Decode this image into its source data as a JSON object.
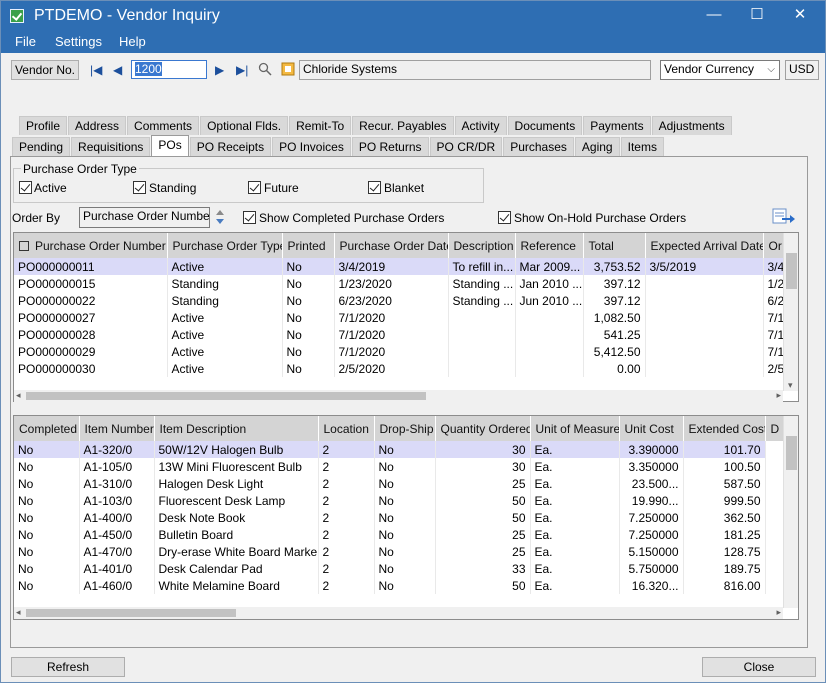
{
  "window": {
    "title": "PTDEMO - Vendor Inquiry",
    "controls": [
      "—",
      "☐",
      "✕"
    ]
  },
  "menu": [
    "File",
    "Settings",
    "Help"
  ],
  "header": {
    "vendor_button": "Vendor No.",
    "vendor_no": "1200",
    "vendor_name": "Chloride Systems",
    "currency_select": "Vendor Currency",
    "currency_code": "USD"
  },
  "tabs_row1": [
    "Profile",
    "Address",
    "Comments",
    "Optional Flds.",
    "Remit-To",
    "Recur. Payables",
    "Activity",
    "Documents",
    "Payments",
    "Adjustments"
  ],
  "tabs_row2": [
    "Pending",
    "Requisitions",
    "POs",
    "PO Receipts",
    "PO Invoices",
    "PO Returns",
    "PO CR/DR",
    "Purchases",
    "Aging",
    "Items"
  ],
  "active_tab": "POs",
  "po_type": {
    "label": "Purchase Order Type",
    "options": [
      {
        "label": "Active",
        "checked": true
      },
      {
        "label": "Standing",
        "checked": true
      },
      {
        "label": "Future",
        "checked": true
      },
      {
        "label": "Blanket",
        "checked": true
      }
    ]
  },
  "order_by": {
    "label": "Order By",
    "value": "Purchase Order Number",
    "show_completed": "Show Completed Purchase Orders",
    "show_onhold": "Show On-Hold Purchase Orders"
  },
  "po_grid": {
    "headers": [
      "Purchase Order Number",
      "Purchase Order Type",
      "Printed",
      "Purchase Order Date",
      "Description",
      "Reference",
      "Total",
      "Expected Arrival Date",
      "Or"
    ],
    "rows": [
      [
        "PO000000011",
        "Active",
        "No",
        "3/4/2019",
        "To refill in...",
        "Mar 2009...",
        "3,753.52",
        "3/5/2019",
        "3/4"
      ],
      [
        "PO000000015",
        "Standing",
        "No",
        "1/23/2020",
        "Standing ...",
        "Jan 2010 ...",
        "397.12",
        "",
        "1/2"
      ],
      [
        "PO000000022",
        "Standing",
        "No",
        "6/23/2020",
        "Standing ...",
        "Jun 2010 ...",
        "397.12",
        "",
        "6/2"
      ],
      [
        "PO000000027",
        "Active",
        "No",
        "7/1/2020",
        "",
        "",
        "1,082.50",
        "",
        "7/1"
      ],
      [
        "PO000000028",
        "Active",
        "No",
        "7/1/2020",
        "",
        "",
        "541.25",
        "",
        "7/1"
      ],
      [
        "PO000000029",
        "Active",
        "No",
        "7/1/2020",
        "",
        "",
        "5,412.50",
        "",
        "7/1"
      ],
      [
        "PO000000030",
        "Active",
        "No",
        "2/5/2020",
        "",
        "",
        "0.00",
        "",
        "2/5"
      ]
    ]
  },
  "item_grid": {
    "headers": [
      "Completed",
      "Item Number",
      "Item Description",
      "Location",
      "Drop-Ship",
      "Quantity Ordered",
      "Unit of Measure",
      "Unit Cost",
      "Extended Cost",
      "D"
    ],
    "rows": [
      [
        "No",
        "A1-320/0",
        "50W/12V Halogen Bulb",
        "2",
        "No",
        "30",
        "Ea.",
        "3.390000",
        "101.70"
      ],
      [
        "No",
        "A1-105/0",
        "13W Mini Fluorescent Bulb",
        "2",
        "No",
        "30",
        "Ea.",
        "3.350000",
        "100.50"
      ],
      [
        "No",
        "A1-310/0",
        "Halogen Desk Light",
        "2",
        "No",
        "25",
        "Ea.",
        "23.500...",
        "587.50"
      ],
      [
        "No",
        "A1-103/0",
        "Fluorescent Desk Lamp",
        "2",
        "No",
        "50",
        "Ea.",
        "19.990...",
        "999.50"
      ],
      [
        "No",
        "A1-400/0",
        "Desk Note Book",
        "2",
        "No",
        "50",
        "Ea.",
        "7.250000",
        "362.50"
      ],
      [
        "No",
        "A1-450/0",
        "Bulletin Board",
        "2",
        "No",
        "25",
        "Ea.",
        "7.250000",
        "181.25"
      ],
      [
        "No",
        "A1-470/0",
        "Dry-erase White Board Markers",
        "2",
        "No",
        "25",
        "Ea.",
        "5.150000",
        "128.75"
      ],
      [
        "No",
        "A1-401/0",
        "Desk Calendar Pad",
        "2",
        "No",
        "33",
        "Ea.",
        "5.750000",
        "189.75"
      ],
      [
        "No",
        "A1-460/0",
        "White Melamine Board",
        "2",
        "No",
        "50",
        "Ea.",
        "16.320...",
        "816.00"
      ]
    ]
  },
  "footer": {
    "refresh": "Refresh",
    "close": "Close"
  }
}
